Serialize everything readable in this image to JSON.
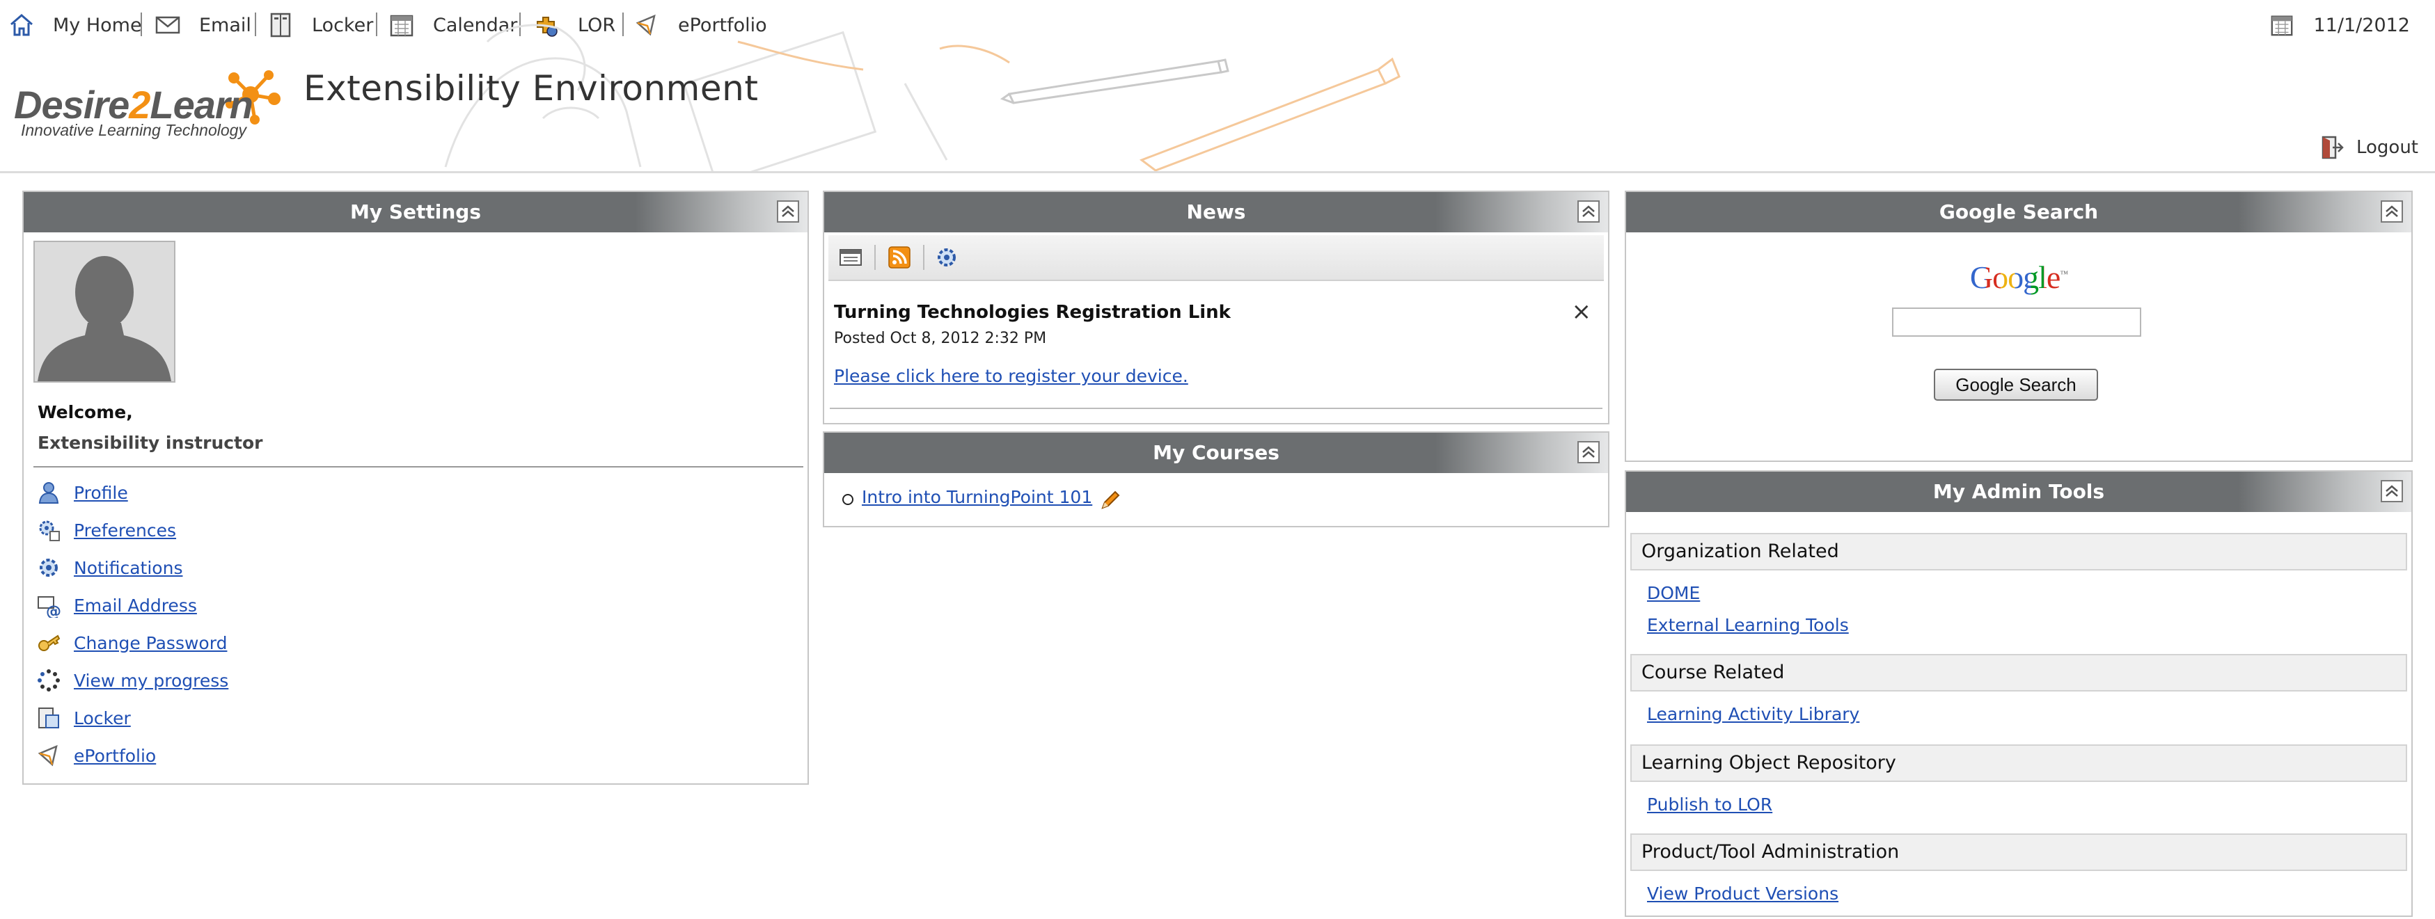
{
  "nav": {
    "items": [
      {
        "label": "My Home",
        "icon": "home-icon"
      },
      {
        "label": "Email",
        "icon": "email-icon"
      },
      {
        "label": "Locker",
        "icon": "locker-icon"
      },
      {
        "label": "Calendar",
        "icon": "calendar-icon"
      },
      {
        "label": "LOR",
        "icon": "lor-icon"
      },
      {
        "label": "ePortfolio",
        "icon": "eportfolio-icon"
      }
    ],
    "date": "11/1/2012"
  },
  "header": {
    "logo_text_a": "Desire",
    "logo_text_b": "2",
    "logo_text_c": "Learn",
    "logo_tagline": "Innovative Learning Technology",
    "site_title": "Extensibility Environment",
    "logout_label": "Logout"
  },
  "colors": {
    "widget_header": "#6b6e70",
    "link": "#1f4fb4",
    "brand_orange": "#f39014"
  },
  "my_settings": {
    "title": "My Settings",
    "welcome": "Welcome,",
    "user_name": "Extensibility instructor",
    "links": [
      {
        "label": "Profile",
        "icon": "profile-icon"
      },
      {
        "label": "Preferences",
        "icon": "preferences-icon"
      },
      {
        "label": "Notifications",
        "icon": "notifications-icon"
      },
      {
        "label": "Email Address",
        "icon": "email-address-icon"
      },
      {
        "label": "Change Password",
        "icon": "key-icon"
      },
      {
        "label": "View my progress",
        "icon": "progress-icon"
      },
      {
        "label": "Locker",
        "icon": "locker-icon"
      },
      {
        "label": "ePortfolio",
        "icon": "eportfolio-icon"
      }
    ]
  },
  "news": {
    "title": "News",
    "item": {
      "title": "Turning Technologies Registration Link",
      "posted": "Posted Oct 8, 2012 2:32 PM",
      "link": "Please click here to register your device.",
      "close": "×"
    }
  },
  "my_courses": {
    "title": "My Courses",
    "courses": [
      {
        "label": "Intro into TurningPoint 101"
      }
    ]
  },
  "google_search": {
    "title": "Google Search",
    "logo": "Google",
    "logo_tm": "™",
    "button_label": "Google Search",
    "input_value": ""
  },
  "admin_tools": {
    "title": "My Admin Tools",
    "sections": [
      {
        "label": "Organization Related",
        "links": [
          "DOME",
          "External Learning Tools"
        ]
      },
      {
        "label": "Course Related",
        "links": [
          "Learning Activity Library"
        ]
      },
      {
        "label": "Learning Object Repository",
        "links": [
          "Publish to LOR"
        ]
      },
      {
        "label": "Product/Tool Administration",
        "links": [
          "View Product Versions"
        ]
      }
    ]
  }
}
